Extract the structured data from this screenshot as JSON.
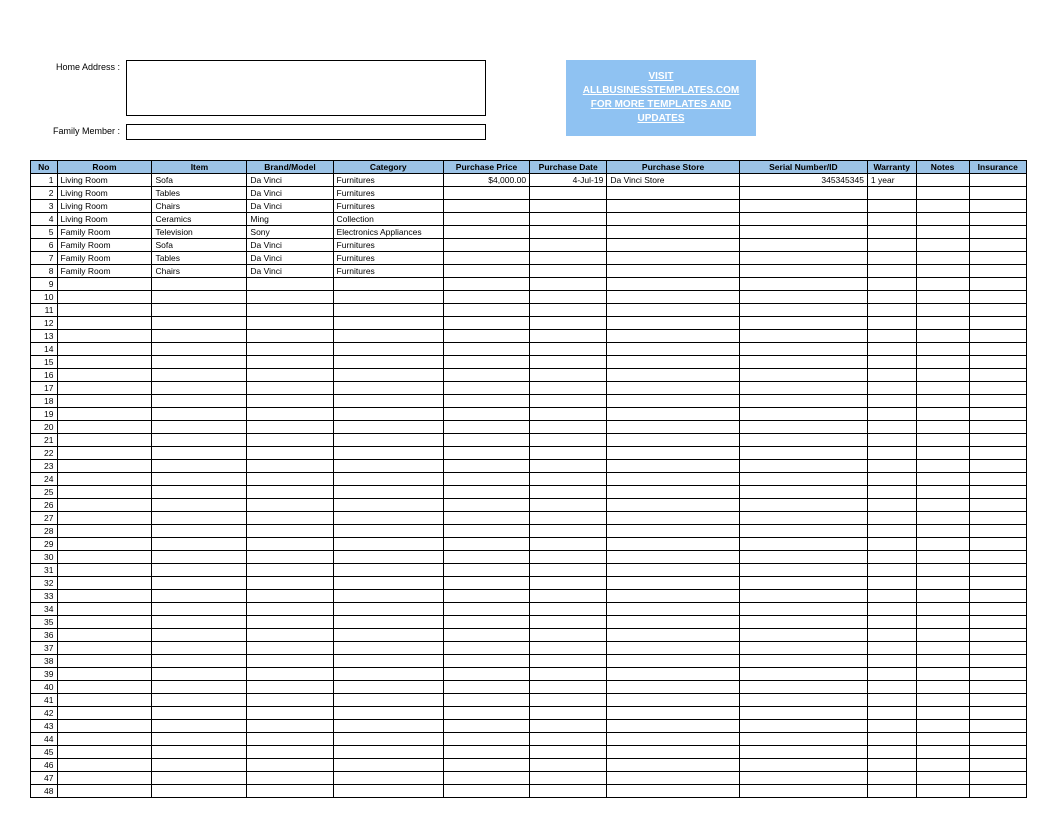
{
  "form": {
    "address_label": "Home Address :",
    "address_value": "",
    "member_label": "Family Member :",
    "member_value": ""
  },
  "banner": {
    "line1": "VISIT",
    "line2": "ALLBUSINESSTEMPLATES.COM",
    "line3": "FOR MORE TEMPLATES AND",
    "line4": "UPDATES"
  },
  "headers": {
    "no": "No",
    "room": "Room",
    "item": "Item",
    "brand": "Brand/Model",
    "category": "Category",
    "price": "Purchase Price",
    "date": "Purchase Date",
    "store": "Purchase Store",
    "serial": "Serial Number/ID",
    "warranty": "Warranty",
    "notes": "Notes",
    "insurance": "Insurance"
  },
  "rows": [
    {
      "no": "1",
      "room": "Living Room",
      "item": "Sofa",
      "brand": "Da Vinci",
      "category": "Furnitures",
      "price": "$4,000.00",
      "date": "4-Jul-19",
      "store": "Da Vinci Store",
      "serial": "345345345",
      "warranty": "1 year",
      "notes": "",
      "insurance": ""
    },
    {
      "no": "2",
      "room": "Living Room",
      "item": "Tables",
      "brand": "Da Vinci",
      "category": "Furnitures",
      "price": "",
      "date": "",
      "store": "",
      "serial": "",
      "warranty": "",
      "notes": "",
      "insurance": ""
    },
    {
      "no": "3",
      "room": "Living Room",
      "item": "Chairs",
      "brand": "Da Vinci",
      "category": "Furnitures",
      "price": "",
      "date": "",
      "store": "",
      "serial": "",
      "warranty": "",
      "notes": "",
      "insurance": ""
    },
    {
      "no": "4",
      "room": "Living Room",
      "item": "Ceramics",
      "brand": "Ming",
      "category": "Collection",
      "price": "",
      "date": "",
      "store": "",
      "serial": "",
      "warranty": "",
      "notes": "",
      "insurance": ""
    },
    {
      "no": "5",
      "room": "Family Room",
      "item": "Television",
      "brand": "Sony",
      "category": "Electronics Appliances",
      "price": "",
      "date": "",
      "store": "",
      "serial": "",
      "warranty": "",
      "notes": "",
      "insurance": ""
    },
    {
      "no": "6",
      "room": "Family Room",
      "item": "Sofa",
      "brand": "Da Vinci",
      "category": "Furnitures",
      "price": "",
      "date": "",
      "store": "",
      "serial": "",
      "warranty": "",
      "notes": "",
      "insurance": ""
    },
    {
      "no": "7",
      "room": "Family Room",
      "item": "Tables",
      "brand": "Da Vinci",
      "category": "Furnitures",
      "price": "",
      "date": "",
      "store": "",
      "serial": "",
      "warranty": "",
      "notes": "",
      "insurance": ""
    },
    {
      "no": "8",
      "room": "Family Room",
      "item": "Chairs",
      "brand": "Da Vinci",
      "category": "Furnitures",
      "price": "",
      "date": "",
      "store": "",
      "serial": "",
      "warranty": "",
      "notes": "",
      "insurance": ""
    }
  ],
  "total_rows": 48
}
